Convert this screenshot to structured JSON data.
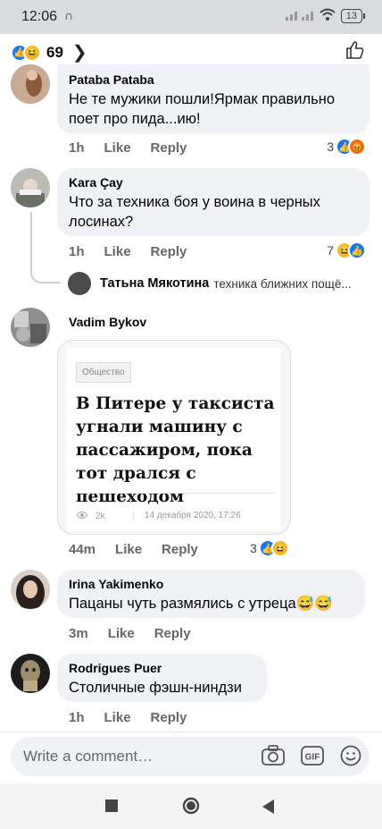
{
  "status": {
    "time": "12:06",
    "battery": "13"
  },
  "header": {
    "reaction_count": "69"
  },
  "comments": [
    {
      "author": "Pataba Pataba",
      "text": "Не те мужики пошли!Ярмак правильно поет про пида...ию!",
      "time": "1h",
      "like": "Like",
      "reply": "Reply",
      "reaction_count": "3"
    },
    {
      "author": "Kara Çay",
      "text": "Что за техника боя у воина в черных лосинах?",
      "time": "1h",
      "like": "Like",
      "reply": "Reply",
      "reaction_count": "7"
    },
    {
      "author": "Vadim Bykov",
      "text": "",
      "time": "44m",
      "like": "Like",
      "reply": "Reply",
      "reaction_count": "3"
    },
    {
      "author": "Irina Yakimenko",
      "text": "Пацаны чуть размялись с утреца😅😅",
      "time": "3m",
      "like": "Like",
      "reply": "Reply"
    },
    {
      "author": "Rodrigues Puer",
      "text": "Столичные фэшн-ниндзи",
      "time": "1h",
      "like": "Like",
      "reply": "Reply"
    }
  ],
  "reply_preview": {
    "name": "Татьна Мякотина",
    "text": "техника ближних пощё..."
  },
  "link_card": {
    "tag": "Общество",
    "headline": "В Питере у таксиста угнали машину с пассажиром, пока тот дрался с пешеходом",
    "views": "2k",
    "date": "14 декабря 2020, 17:26"
  },
  "composer": {
    "placeholder": "Write a comment…"
  },
  "colors": {
    "bubble": "#f0f2f5",
    "like_blue": "#1877f2",
    "haha_yellow": "#f7b928",
    "angry_orange": "#e9710f",
    "meta_gray": "#65676b"
  }
}
